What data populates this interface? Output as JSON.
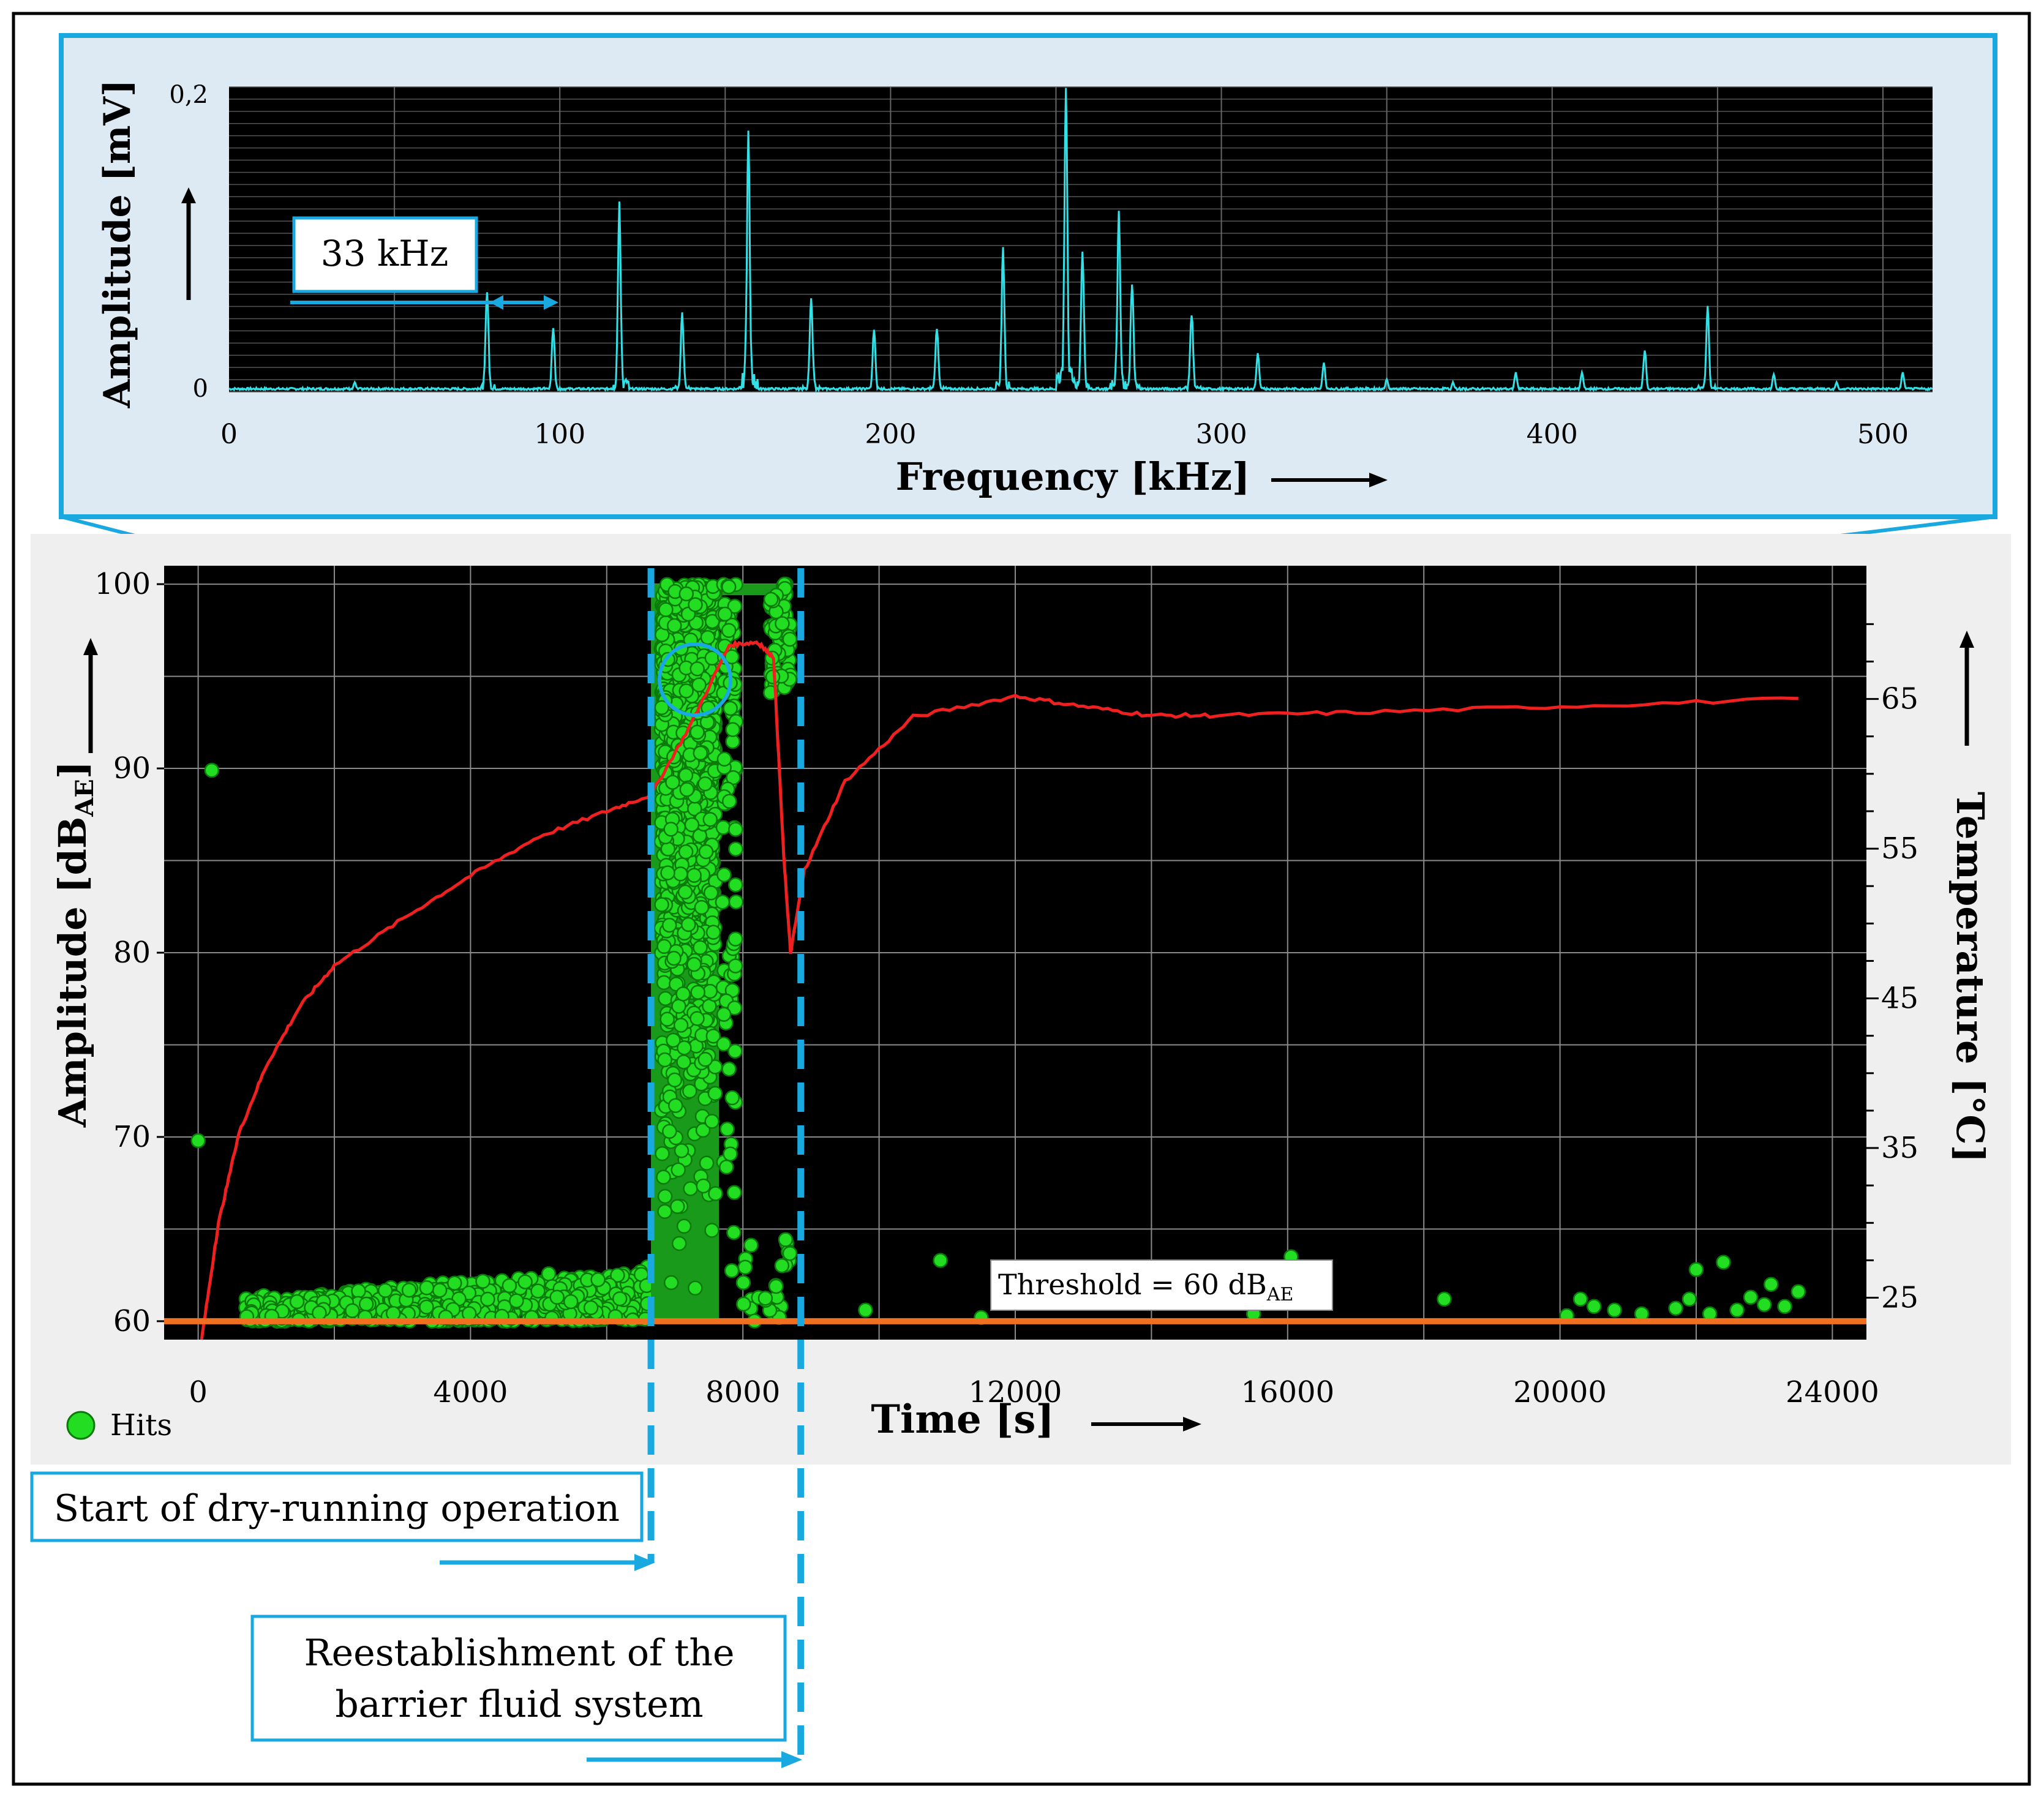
{
  "spectrum": {
    "ylabel": "Amplitude [mV]",
    "xlabel": "Frequency [kHz]",
    "x_ticks": [
      0,
      100,
      200,
      300,
      400,
      500
    ],
    "y_ticks": [
      "0",
      "0,2"
    ],
    "callout": "33 kHz",
    "colors": {
      "line": "#33e0e6",
      "plot_bg": "#000000",
      "panel_bg": "#dde9f3",
      "frame": "#1aa8e0"
    }
  },
  "main": {
    "ylabel_prefix": "Amplitude [dB",
    "ylabel_sub": "AE",
    "ylabel_suffix": "]",
    "y2label": "Temperature [°C]",
    "xlabel": "Time [s]",
    "x_ticks": [
      0,
      4000,
      8000,
      12000,
      16000,
      20000,
      24000
    ],
    "y_ticks": [
      60,
      70,
      80,
      90,
      100
    ],
    "y2_ticks": [
      25,
      35,
      45,
      55,
      65
    ],
    "legend": "Hits",
    "threshold_prefix": "Threshold = 60 dB",
    "threshold_sub": "AE",
    "colors": {
      "hits": "#22dd22",
      "hits_dark": "#1a9a1a",
      "temperature": "#ee2020",
      "threshold": "#f07020",
      "marker": "#1aa8e0",
      "panel_bg": "#efefef"
    }
  },
  "annotations": {
    "start": "Start of dry-running operation",
    "reestablish_line1": "Reestablishment of the",
    "reestablish_line2": "barrier fluid system"
  },
  "chart_data": [
    {
      "type": "line",
      "xlabel": "Frequency [kHz]",
      "ylabel": "Amplitude [mV]",
      "xlim": [
        0,
        515
      ],
      "ylim": [
        0,
        0.2
      ],
      "peaks": [
        [
          38,
          0.006
        ],
        [
          78,
          0.065
        ],
        [
          98,
          0.041
        ],
        [
          118,
          0.116
        ],
        [
          137,
          0.049
        ],
        [
          157,
          0.16
        ],
        [
          176,
          0.058
        ],
        [
          195,
          0.039
        ],
        [
          214,
          0.041
        ],
        [
          234,
          0.089
        ],
        [
          253,
          0.197
        ],
        [
          258,
          0.09
        ],
        [
          269,
          0.113
        ],
        [
          273,
          0.07
        ],
        [
          291,
          0.05
        ],
        [
          311,
          0.024
        ],
        [
          331,
          0.018
        ],
        [
          350,
          0.008
        ],
        [
          370,
          0.006
        ],
        [
          389,
          0.012
        ],
        [
          409,
          0.012
        ],
        [
          428,
          0.026
        ],
        [
          447,
          0.054
        ],
        [
          467,
          0.011
        ],
        [
          486,
          0.006
        ],
        [
          506,
          0.012
        ]
      ],
      "annotation": "33 kHz"
    },
    {
      "type": "scatter",
      "xlabel": "Time [s]",
      "ylabel": "Amplitude [dBAE]",
      "y2label": "Temperature [°C]",
      "xlim": [
        -500,
        24500
      ],
      "ylim": [
        59,
        101
      ],
      "y2lim": [
        22.2,
        73.9
      ],
      "threshold": 60,
      "dry_running_start": 6650,
      "reestablishment": 8850,
      "hit_series": {
        "name": "Hits",
        "isolated_points": [
          [
            0,
            69.8
          ],
          [
            200,
            89.9
          ],
          [
            10900,
            63.3
          ],
          [
            11500,
            60.2
          ],
          [
            15500,
            60.4
          ],
          [
            16050,
            63.5
          ],
          [
            16000,
            61.5
          ],
          [
            18300,
            61.2
          ],
          [
            20100,
            60.3
          ],
          [
            20300,
            61.2
          ],
          [
            20500,
            60.8
          ],
          [
            20800,
            60.6
          ],
          [
            21200,
            60.4
          ],
          [
            21700,
            60.7
          ],
          [
            21900,
            61.2
          ],
          [
            22000,
            62.8
          ],
          [
            22200,
            60.4
          ],
          [
            22400,
            63.2
          ],
          [
            22600,
            60.6
          ],
          [
            22800,
            61.3
          ],
          [
            23000,
            60.9
          ],
          [
            23100,
            62.0
          ],
          [
            23300,
            60.8
          ],
          [
            23500,
            61.6
          ],
          [
            9800,
            60.6
          ]
        ]
      },
      "temperature_series": {
        "name": "Temperature",
        "points": [
          [
            50,
            22.2
          ],
          [
            300,
            30
          ],
          [
            600,
            36
          ],
          [
            1000,
            40.5
          ],
          [
            1500,
            44.5
          ],
          [
            2000,
            47.2
          ],
          [
            3000,
            50.3
          ],
          [
            4000,
            53.2
          ],
          [
            5000,
            55.8
          ],
          [
            6000,
            57.5
          ],
          [
            6650,
            58.6
          ],
          [
            7200,
            63
          ],
          [
            7800,
            68.6
          ],
          [
            8200,
            68.8
          ],
          [
            8450,
            67.8
          ],
          [
            8600,
            54.5
          ],
          [
            8700,
            48.0
          ],
          [
            8900,
            53.5
          ],
          [
            9500,
            59.5
          ],
          [
            10500,
            63.8
          ],
          [
            12000,
            65.2
          ],
          [
            13000,
            64.5
          ],
          [
            14000,
            63.9
          ],
          [
            15000,
            63.9
          ],
          [
            17000,
            64.1
          ],
          [
            20000,
            64.5
          ],
          [
            23500,
            65.0
          ]
        ]
      }
    }
  ]
}
